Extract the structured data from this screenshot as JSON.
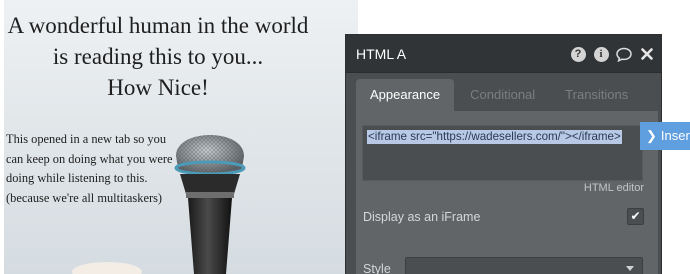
{
  "preview": {
    "headline": [
      "A wonderful human in the world",
      "is reading this to you...",
      "How Nice!"
    ],
    "body": [
      "This opened in a new tab so you",
      "can keep on doing what you were",
      "doing while listening to this.",
      "(because we're all multitaskers)"
    ]
  },
  "panel": {
    "title": "HTML A",
    "header_icons": [
      "help-icon",
      "info-icon",
      "comment-icon",
      "close-icon"
    ],
    "tabs": [
      {
        "label": "Appearance",
        "active": true
      },
      {
        "label": "Conditional",
        "active": false
      },
      {
        "label": "Transitions",
        "active": false
      }
    ],
    "html_code": "<iframe src=\"https://wadesellers.com/\"></iframe>",
    "html_editor_label": "HTML editor",
    "iframe_label": "Display as an iFrame",
    "iframe_checked": true,
    "style_label": "Style",
    "style_value": ""
  },
  "insert_button": {
    "label": "Inser"
  },
  "colors": {
    "panel_bg": "#4b4e51",
    "panel_header": "#313436",
    "tab_active": "#626567",
    "selection": "#b8c9e5",
    "insert_button": "#5f9edf"
  }
}
